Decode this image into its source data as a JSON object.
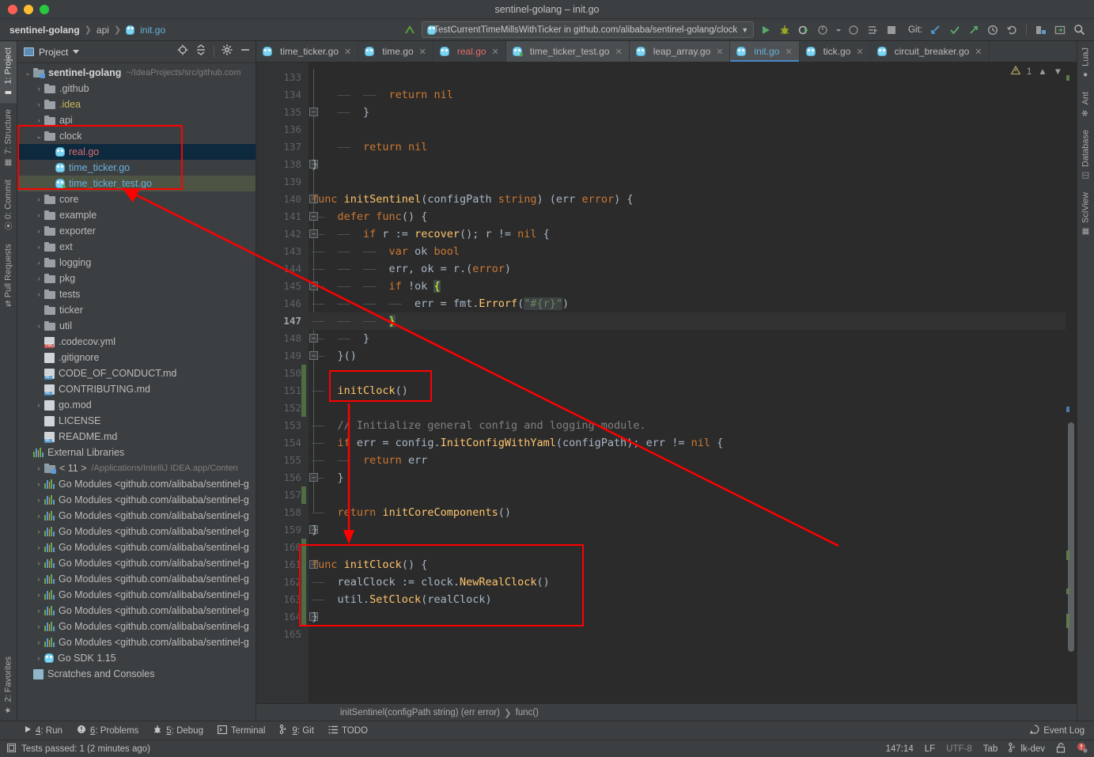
{
  "window": {
    "title": "sentinel-golang – init.go"
  },
  "navbar": {
    "breadcrumbs": [
      "sentinel-golang",
      "api",
      "init.go"
    ],
    "run_config": "TestCurrentTimeMillsWithTicker in github.com/alibaba/sentinel-golang/clock",
    "git_label": "Git:"
  },
  "left_strip": {
    "top": [
      "1: Project",
      "7: Structure",
      "0: Commit",
      "Pull Requests"
    ],
    "bottom": [
      "2: Favorites"
    ]
  },
  "right_strip": {
    "items": [
      "LuaJ",
      "Ant",
      "Database",
      "SciView"
    ]
  },
  "project": {
    "title": "Project",
    "root": {
      "label": "sentinel-golang",
      "path": "~/IdeaProjects/src/github.com"
    },
    "items": [
      {
        "label": ".github",
        "type": "folder",
        "arrow": "›",
        "indent": 1
      },
      {
        "label": ".idea",
        "type": "folder",
        "arrow": "›",
        "indent": 1,
        "color": "yellow"
      },
      {
        "label": "api",
        "type": "folder",
        "arrow": "›",
        "indent": 1
      },
      {
        "label": "clock",
        "type": "folder",
        "arrow": "⌄",
        "indent": 1,
        "expanded": true
      },
      {
        "label": "real.go",
        "type": "go",
        "indent": 2,
        "color": "red",
        "select": "blue"
      },
      {
        "label": "time_ticker.go",
        "type": "go",
        "indent": 2,
        "color": "blue"
      },
      {
        "label": "time_ticker_test.go",
        "type": "gotest",
        "indent": 2,
        "color": "blue",
        "select": "green"
      },
      {
        "label": "core",
        "type": "folder",
        "arrow": "›",
        "indent": 1
      },
      {
        "label": "example",
        "type": "folder",
        "arrow": "›",
        "indent": 1
      },
      {
        "label": "exporter",
        "type": "folder",
        "arrow": "›",
        "indent": 1
      },
      {
        "label": "ext",
        "type": "folder",
        "arrow": "›",
        "indent": 1
      },
      {
        "label": "logging",
        "type": "folder",
        "arrow": "›",
        "indent": 1
      },
      {
        "label": "pkg",
        "type": "folder",
        "arrow": "›",
        "indent": 1
      },
      {
        "label": "tests",
        "type": "folder",
        "arrow": "›",
        "indent": 1
      },
      {
        "label": "ticker",
        "type": "folder",
        "indent": 1
      },
      {
        "label": "util",
        "type": "folder",
        "arrow": "›",
        "indent": 1
      },
      {
        "label": ".codecov.yml",
        "type": "yml",
        "indent": 1
      },
      {
        "label": ".gitignore",
        "type": "file",
        "indent": 1
      },
      {
        "label": "CODE_OF_CONDUCT.md",
        "type": "md",
        "indent": 1
      },
      {
        "label": "CONTRIBUTING.md",
        "type": "md",
        "indent": 1
      },
      {
        "label": "go.mod",
        "type": "file",
        "arrow": "›",
        "indent": 1
      },
      {
        "label": "LICENSE",
        "type": "file",
        "indent": 1
      },
      {
        "label": "README.md",
        "type": "md",
        "indent": 1
      },
      {
        "label": "External Libraries",
        "type": "lib",
        "indent": 0
      },
      {
        "label": "< 11 >",
        "note": "/Applications/IntelliJ IDEA.app/Conten",
        "type": "modfolder",
        "arrow": "›",
        "indent": 1
      },
      {
        "label": "Go Modules <github.com/alibaba/sentinel-g",
        "type": "lib",
        "arrow": "›",
        "indent": 1
      },
      {
        "label": "Go Modules <github.com/alibaba/sentinel-g",
        "type": "lib",
        "arrow": "›",
        "indent": 1
      },
      {
        "label": "Go Modules <github.com/alibaba/sentinel-g",
        "type": "lib",
        "arrow": "›",
        "indent": 1
      },
      {
        "label": "Go Modules <github.com/alibaba/sentinel-g",
        "type": "lib",
        "arrow": "›",
        "indent": 1
      },
      {
        "label": "Go Modules <github.com/alibaba/sentinel-g",
        "type": "lib",
        "arrow": "›",
        "indent": 1
      },
      {
        "label": "Go Modules <github.com/alibaba/sentinel-g",
        "type": "lib",
        "arrow": "›",
        "indent": 1
      },
      {
        "label": "Go Modules <github.com/alibaba/sentinel-g",
        "type": "lib",
        "arrow": "›",
        "indent": 1
      },
      {
        "label": "Go Modules <github.com/alibaba/sentinel-g",
        "type": "lib",
        "arrow": "›",
        "indent": 1
      },
      {
        "label": "Go Modules <github.com/alibaba/sentinel-g",
        "type": "lib",
        "arrow": "›",
        "indent": 1
      },
      {
        "label": "Go Modules <github.com/alibaba/sentinel-g",
        "type": "lib",
        "arrow": "›",
        "indent": 1
      },
      {
        "label": "Go Modules <github.com/alibaba/sentinel-g",
        "type": "lib",
        "arrow": "›",
        "indent": 1
      },
      {
        "label": "Go SDK 1.15",
        "type": "go",
        "arrow": "›",
        "indent": 1
      },
      {
        "label": "Scratches and Consoles",
        "type": "scratch",
        "indent": 0
      }
    ]
  },
  "tabs": [
    {
      "label": "time_ticker.go",
      "color": "",
      "active": false
    },
    {
      "label": "time.go",
      "color": "",
      "active": false
    },
    {
      "label": "real.go",
      "color": "red",
      "active": false
    },
    {
      "label": "time_ticker_test.go",
      "color": "",
      "active": false,
      "test": true,
      "hl": true
    },
    {
      "label": "leap_array.go",
      "color": "",
      "active": false,
      "hl": true
    },
    {
      "label": "init.go",
      "color": "blue",
      "active": true
    },
    {
      "label": "tick.go",
      "color": "",
      "active": false
    },
    {
      "label": "circuit_breaker.go",
      "color": "",
      "active": false
    }
  ],
  "editor": {
    "warning_count": "1",
    "first_line": 133,
    "current_line": 147,
    "lines": [
      {
        "n": 133,
        "tokens": []
      },
      {
        "n": 134,
        "tokens": [
          {
            "t": "ind",
            "v": "    ——  ——  "
          },
          {
            "t": "kw",
            "v": "return"
          },
          {
            "t": "txt",
            "v": " "
          },
          {
            "t": "kw",
            "v": "nil"
          }
        ]
      },
      {
        "n": 135,
        "tokens": [
          {
            "t": "ind",
            "v": "    ——  "
          },
          {
            "t": "txt",
            "v": "}"
          }
        ]
      },
      {
        "n": 136,
        "tokens": []
      },
      {
        "n": 137,
        "tokens": [
          {
            "t": "ind",
            "v": "    ——  "
          },
          {
            "t": "kw",
            "v": "return"
          },
          {
            "t": "txt",
            "v": " "
          },
          {
            "t": "kw",
            "v": "nil"
          }
        ]
      },
      {
        "n": 138,
        "tokens": [
          {
            "t": "txt",
            "v": "}"
          }
        ]
      },
      {
        "n": 139,
        "tokens": []
      },
      {
        "n": 140,
        "tokens": [
          {
            "t": "kw",
            "v": "func"
          },
          {
            "t": "txt",
            "v": " "
          },
          {
            "t": "fn",
            "v": "initSentinel"
          },
          {
            "t": "txt",
            "v": "(configPath "
          },
          {
            "t": "kw",
            "v": "string"
          },
          {
            "t": "txt",
            "v": ") (err "
          },
          {
            "t": "kw",
            "v": "error"
          },
          {
            "t": "txt",
            "v": ") {"
          }
        ]
      },
      {
        "n": 141,
        "tokens": [
          {
            "t": "ind",
            "v": "——  "
          },
          {
            "t": "kw",
            "v": "defer"
          },
          {
            "t": "txt",
            "v": " "
          },
          {
            "t": "kw",
            "v": "func"
          },
          {
            "t": "txt",
            "v": "() {"
          }
        ]
      },
      {
        "n": 142,
        "tokens": [
          {
            "t": "ind",
            "v": "——  ——  "
          },
          {
            "t": "kw",
            "v": "if"
          },
          {
            "t": "txt",
            "v": " r := "
          },
          {
            "t": "fn",
            "v": "recover"
          },
          {
            "t": "txt",
            "v": "(); r != "
          },
          {
            "t": "kw",
            "v": "nil"
          },
          {
            "t": "txt",
            "v": " {"
          }
        ]
      },
      {
        "n": 143,
        "tokens": [
          {
            "t": "ind",
            "v": "——  ——  ——  "
          },
          {
            "t": "kw",
            "v": "var"
          },
          {
            "t": "txt",
            "v": " ok "
          },
          {
            "t": "kw",
            "v": "bool"
          }
        ]
      },
      {
        "n": 144,
        "tokens": [
          {
            "t": "ind",
            "v": "——  ——  ——  "
          },
          {
            "t": "txt",
            "v": "err, ok = r.("
          },
          {
            "t": "kw",
            "v": "error"
          },
          {
            "t": "txt",
            "v": ")"
          }
        ]
      },
      {
        "n": 145,
        "tokens": [
          {
            "t": "ind",
            "v": "——  ——  ——  "
          },
          {
            "t": "kw",
            "v": "if"
          },
          {
            "t": "txt",
            "v": " !ok "
          },
          {
            "t": "brace",
            "v": "{"
          }
        ]
      },
      {
        "n": 146,
        "tokens": [
          {
            "t": "ind",
            "v": "——  ——  ——  ——  "
          },
          {
            "t": "txt",
            "v": "err = fmt."
          },
          {
            "t": "fn",
            "v": "Errorf"
          },
          {
            "t": "txt",
            "v": "("
          },
          {
            "t": "strhl",
            "v": "\"#{r}\""
          },
          {
            "t": "txt",
            "v": ")"
          }
        ]
      },
      {
        "n": 147,
        "tokens": [
          {
            "t": "ind",
            "v": "——  ——  ——  "
          },
          {
            "t": "brace",
            "v": "}"
          }
        ],
        "current": true
      },
      {
        "n": 148,
        "tokens": [
          {
            "t": "ind",
            "v": "——  ——  "
          },
          {
            "t": "txt",
            "v": "}"
          }
        ]
      },
      {
        "n": 149,
        "tokens": [
          {
            "t": "ind",
            "v": "——  "
          },
          {
            "t": "txt",
            "v": "}()"
          }
        ]
      },
      {
        "n": 150,
        "tokens": []
      },
      {
        "n": 151,
        "tokens": [
          {
            "t": "ind",
            "v": "——  "
          },
          {
            "t": "fn",
            "v": "initClock"
          },
          {
            "t": "txt",
            "v": "()"
          }
        ]
      },
      {
        "n": 152,
        "tokens": []
      },
      {
        "n": 153,
        "tokens": [
          {
            "t": "ind",
            "v": "——  "
          },
          {
            "t": "com",
            "v": "// Initialize general config and logging module."
          }
        ]
      },
      {
        "n": 154,
        "tokens": [
          {
            "t": "ind",
            "v": "——  "
          },
          {
            "t": "kw",
            "v": "if"
          },
          {
            "t": "txt",
            "v": " err = config."
          },
          {
            "t": "fn",
            "v": "InitConfigWithYaml"
          },
          {
            "t": "txt",
            "v": "(configPath); err != "
          },
          {
            "t": "kw",
            "v": "nil"
          },
          {
            "t": "txt",
            "v": " {"
          }
        ]
      },
      {
        "n": 155,
        "tokens": [
          {
            "t": "ind",
            "v": "——  ——  "
          },
          {
            "t": "kw",
            "v": "return"
          },
          {
            "t": "txt",
            "v": " err"
          }
        ]
      },
      {
        "n": 156,
        "tokens": [
          {
            "t": "ind",
            "v": "——  "
          },
          {
            "t": "txt",
            "v": "}"
          }
        ]
      },
      {
        "n": 157,
        "tokens": []
      },
      {
        "n": 158,
        "tokens": [
          {
            "t": "ind",
            "v": "——  "
          },
          {
            "t": "kw",
            "v": "return"
          },
          {
            "t": "txt",
            "v": " "
          },
          {
            "t": "fn",
            "v": "initCoreComponents"
          },
          {
            "t": "txt",
            "v": "()"
          }
        ]
      },
      {
        "n": 159,
        "tokens": [
          {
            "t": "txt",
            "v": "}"
          }
        ]
      },
      {
        "n": 160,
        "tokens": []
      },
      {
        "n": 161,
        "tokens": [
          {
            "t": "kw",
            "v": "func"
          },
          {
            "t": "txt",
            "v": " "
          },
          {
            "t": "fn",
            "v": "initClock"
          },
          {
            "t": "txt",
            "v": "() {"
          }
        ]
      },
      {
        "n": 162,
        "tokens": [
          {
            "t": "ind",
            "v": "——  "
          },
          {
            "t": "txt",
            "v": "realClock := clock."
          },
          {
            "t": "fn",
            "v": "NewRealClock"
          },
          {
            "t": "txt",
            "v": "()"
          }
        ]
      },
      {
        "n": 163,
        "tokens": [
          {
            "t": "ind",
            "v": "——  "
          },
          {
            "t": "txt",
            "v": "util."
          },
          {
            "t": "fn",
            "v": "SetClock"
          },
          {
            "t": "txt",
            "v": "(realClock)"
          }
        ]
      },
      {
        "n": 164,
        "tokens": [
          {
            "t": "txt",
            "v": "}"
          }
        ]
      },
      {
        "n": 165,
        "tokens": []
      }
    ],
    "breadcrumb": [
      "initSentinel(configPath string) (err error)",
      "func()"
    ]
  },
  "toolwindow_bar": {
    "items": [
      {
        "num": "4",
        "label": ": Run",
        "icon": "run-icon"
      },
      {
        "num": "6",
        "label": ": Problems",
        "icon": "problems-icon"
      },
      {
        "num": "5",
        "label": ": Debug",
        "icon": "debug-icon"
      },
      {
        "num": "",
        "label": "Terminal",
        "icon": "terminal-icon"
      },
      {
        "num": "9",
        "label": ": Git",
        "icon": "git-icon"
      },
      {
        "num": "",
        "label": "TODO",
        "icon": "todo-icon"
      }
    ],
    "event_log": "Event Log"
  },
  "status": {
    "message": "Tests passed: 1 (2 minutes ago)",
    "caret": "147:14",
    "line_sep": "LF",
    "encoding": "UTF-8",
    "indent": "Tab",
    "branch": "lk-dev"
  }
}
